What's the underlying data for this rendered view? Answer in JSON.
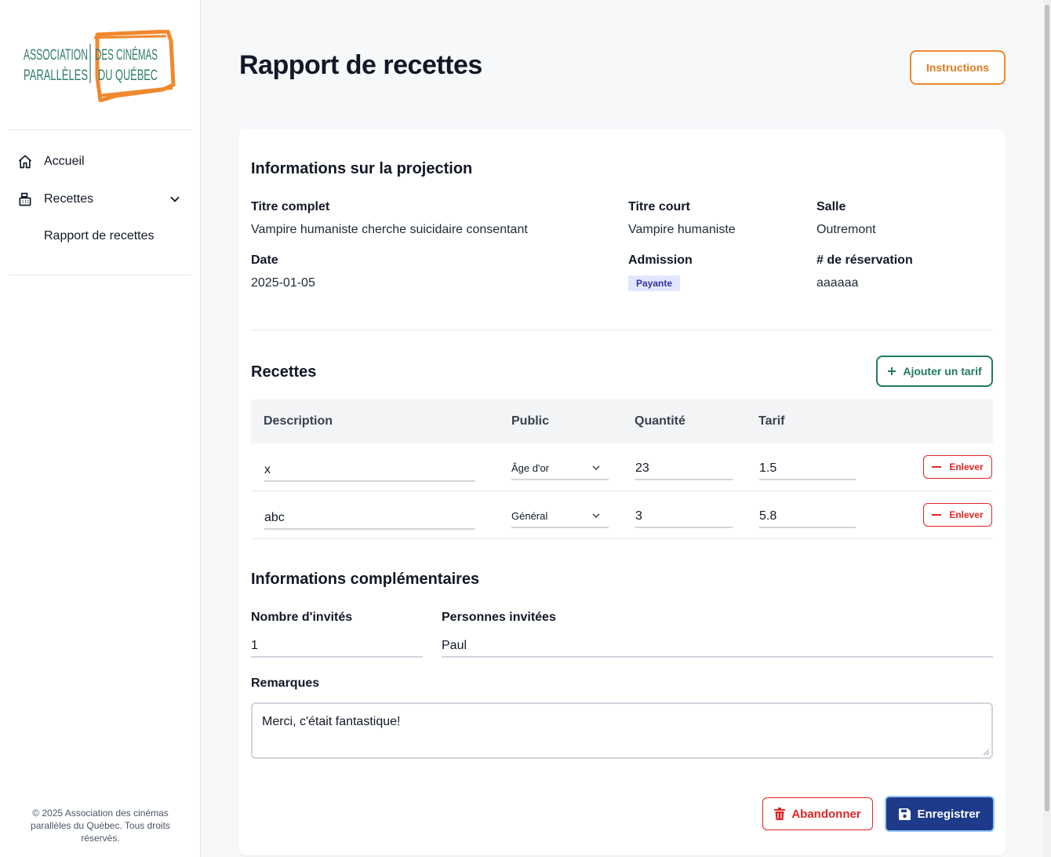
{
  "brand": {
    "logo_line1_left": "ASSOCIATION",
    "logo_line2_left": "PARALLÈLES",
    "logo_line1_right": "DES CINÉMAS",
    "logo_line2_right": "DU QUÉBEC",
    "accent": "#f0892e",
    "logo_text_color": "#2e7d6b"
  },
  "sidebar": {
    "items": [
      {
        "label": "Accueil",
        "icon": "home-icon"
      },
      {
        "label": "Recettes",
        "icon": "cash-register-icon",
        "expanded": true
      }
    ],
    "sub_items": [
      {
        "label": "Rapport de recettes"
      }
    ],
    "footer": "© 2025 Association des cinémas parallèles du Québec. Tous droits réservés."
  },
  "header": {
    "title": "Rapport de recettes",
    "instructions_label": "Instructions"
  },
  "projection": {
    "heading": "Informations sur la projection",
    "full_title_label": "Titre complet",
    "full_title": "Vampire humaniste cherche suicidaire consentant",
    "short_title_label": "Titre court",
    "short_title": "Vampire humaniste",
    "room_label": "Salle",
    "room": "Outremont",
    "date_label": "Date",
    "date": "2025-01-05",
    "admission_label": "Admission",
    "admission": "Payante",
    "reservation_label": "# de réservation",
    "reservation": "aaaaaa"
  },
  "receipts": {
    "heading": "Recettes",
    "add_label": "Ajouter un tarif",
    "columns": [
      "Description",
      "Public",
      "Quantité",
      "Tarif"
    ],
    "remove_label": "Enlever",
    "rows": [
      {
        "description": "x",
        "public": "Âge d'or",
        "quantity": "23",
        "rate": "1.5"
      },
      {
        "description": "abc",
        "public": "Général",
        "quantity": "3",
        "rate": "5.8"
      }
    ]
  },
  "extra": {
    "heading": "Informations complémentaires",
    "guests_count_label": "Nombre d'invités",
    "guests_count": "1",
    "guests_names_label": "Personnes invitées",
    "guests_names": "Paul",
    "remarks_label": "Remarques",
    "remarks": "Merci, c'était fantastique!"
  },
  "actions": {
    "abandon_label": "Abandonner",
    "save_label": "Enregistrer"
  }
}
